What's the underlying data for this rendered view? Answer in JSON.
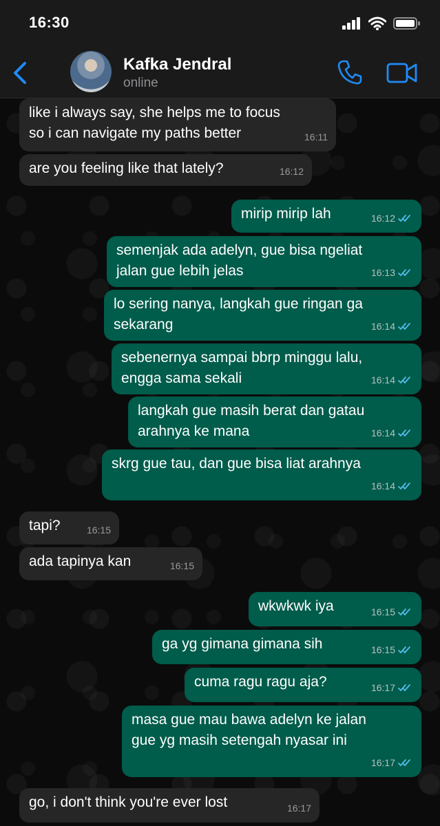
{
  "status": {
    "time": "16:30"
  },
  "header": {
    "contact_name": "Kafka Jendral",
    "contact_status": "online"
  },
  "colors": {
    "accent": "#1f8bf5",
    "outgoing": "#005c4b",
    "incoming": "#262626",
    "read_ticks": "#53bdeb"
  },
  "messages": [
    {
      "dir": "in",
      "text": "like i always say, she helps me to focus\nso i can navigate my paths better",
      "time": "16:11"
    },
    {
      "dir": "in",
      "text": "are you feeling like that lately?",
      "time": "16:12"
    },
    {
      "dir": "out",
      "text": "mirip mirip lah",
      "time": "16:12"
    },
    {
      "dir": "out",
      "text": "semenjak ada adelyn, gue bisa ngeliat\njalan gue lebih jelas",
      "time": "16:13"
    },
    {
      "dir": "out",
      "text": "lo sering nanya, langkah gue ringan ga\nsekarang",
      "time": "16:14"
    },
    {
      "dir": "out",
      "text": "sebenernya sampai bbrp minggu lalu,\nengga sama sekali",
      "time": "16:14"
    },
    {
      "dir": "out",
      "text": "langkah gue masih berat dan gatau\narahnya ke mana",
      "time": "16:14"
    },
    {
      "dir": "out",
      "text": "skrg gue tau, dan gue bisa liat arahnya",
      "time": "16:14"
    },
    {
      "dir": "in",
      "text": "tapi?",
      "time": "16:15"
    },
    {
      "dir": "in",
      "text": "ada tapinya kan",
      "time": "16:15"
    },
    {
      "dir": "out",
      "text": "wkwkwk iya",
      "time": "16:15"
    },
    {
      "dir": "out",
      "text": "ga yg gimana gimana sih",
      "time": "16:15"
    },
    {
      "dir": "out",
      "text": "cuma ragu ragu aja?",
      "time": "16:17"
    },
    {
      "dir": "out",
      "text": "masa gue mau bawa adelyn ke jalan\ngue yg masih setengah nyasar ini",
      "time": "16:17"
    },
    {
      "dir": "in",
      "text": "go, i don't think you're ever lost",
      "time": "16:17"
    }
  ]
}
